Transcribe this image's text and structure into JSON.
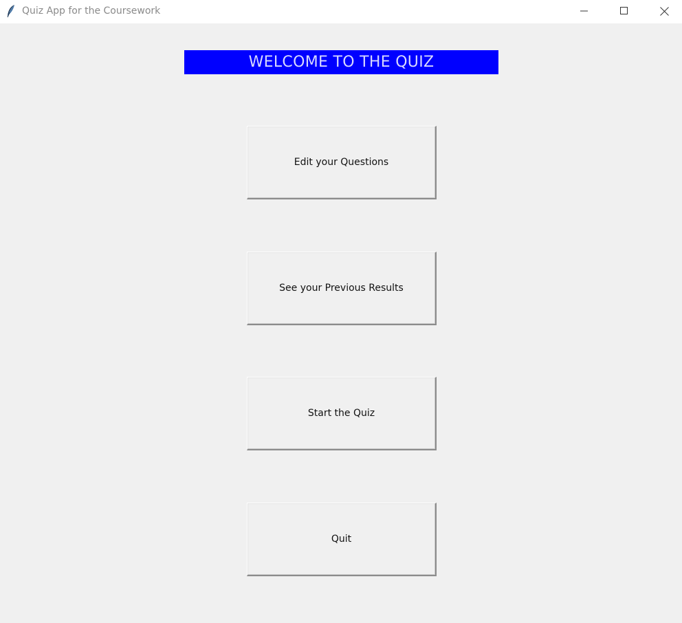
{
  "window": {
    "title": "Quiz App for the Coursework",
    "icon": "feather-icon",
    "controls": {
      "minimize": "minimize-icon",
      "maximize": "maximize-icon",
      "close": "close-icon"
    }
  },
  "header": {
    "banner_text": "WELCOME TO THE QUIZ",
    "banner_bg": "#0000ff",
    "banner_fg": "#d8d8ff"
  },
  "menu": {
    "edit_label": "Edit your Questions",
    "results_label": "See your Previous Results",
    "start_label": "Start the Quiz",
    "quit_label": "Quit"
  },
  "colors": {
    "window_bg": "#f0f0f0",
    "titlebar_bg": "#ffffff",
    "title_text": "#8a8a8a"
  }
}
